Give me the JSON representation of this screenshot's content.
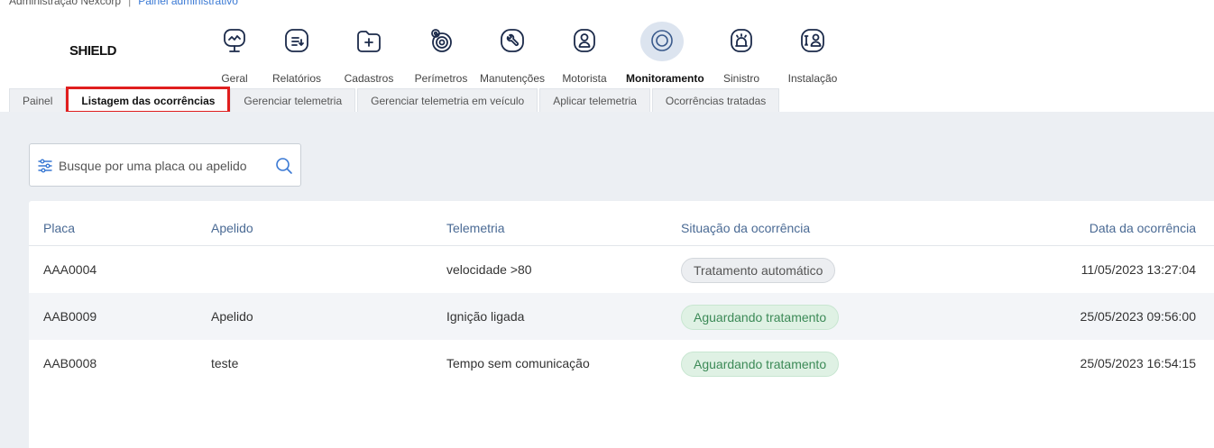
{
  "breadcrumb": {
    "org": "Administração Nexcorp",
    "separator": "|",
    "section": "Painel administrativo"
  },
  "logo": "SHIELD",
  "modules": [
    {
      "label": "Geral",
      "icon": "monitor-icon"
    },
    {
      "label": "Relatórios",
      "icon": "report-icon"
    },
    {
      "label": "Cadastros",
      "icon": "folder-plus-icon"
    },
    {
      "label": "Perímetros",
      "icon": "location-target-icon"
    },
    {
      "label": "Manutenções",
      "icon": "wrench-icon"
    },
    {
      "label": "Motorista",
      "icon": "driver-icon"
    },
    {
      "label": "Monitoramento",
      "icon": "monitoring-icon",
      "active": true
    },
    {
      "label": "Sinistro",
      "icon": "alarm-icon"
    },
    {
      "label": "Instalação",
      "icon": "installation-icon"
    }
  ],
  "tabs": [
    {
      "label": "Painel"
    },
    {
      "label": "Listagem das ocorrências",
      "active": true
    },
    {
      "label": "Gerenciar telemetria"
    },
    {
      "label": "Gerenciar telemetria em veículo"
    },
    {
      "label": "Aplicar telemetria"
    },
    {
      "label": "Ocorrências tratadas"
    }
  ],
  "search": {
    "placeholder": "Busque por uma placa ou apelido",
    "value": ""
  },
  "table": {
    "headers": {
      "placa": "Placa",
      "apelido": "Apelido",
      "telemetria": "Telemetria",
      "situacao": "Situação da ocorrência",
      "data": "Data da ocorrência"
    },
    "rows": [
      {
        "placa": "AAA0004",
        "apelido": "",
        "telemetria": "velocidade >80",
        "situacao": "Tratamento automático",
        "data": "11/05/2023 13:27:04"
      },
      {
        "placa": "AAB0009",
        "apelido": "Apelido",
        "telemetria": "Ignição ligada",
        "situacao": "Aguardando tratamento",
        "data": "25/05/2023 09:56:00"
      },
      {
        "placa": "AAB0008",
        "apelido": "teste",
        "telemetria": "Tempo sem comunicação",
        "situacao": "Aguardando tratamento",
        "data": "25/05/2023 16:54:15"
      }
    ]
  },
  "colors": {
    "accent": "#1b2a4a",
    "active_halo": "#dce4ef",
    "highlight": "#e01e1e",
    "header_text": "#4a6a94",
    "badge_wait_bg": "#dff1e4",
    "badge_wait_text": "#3c8a57",
    "badge_auto_bg": "#eceef1"
  }
}
